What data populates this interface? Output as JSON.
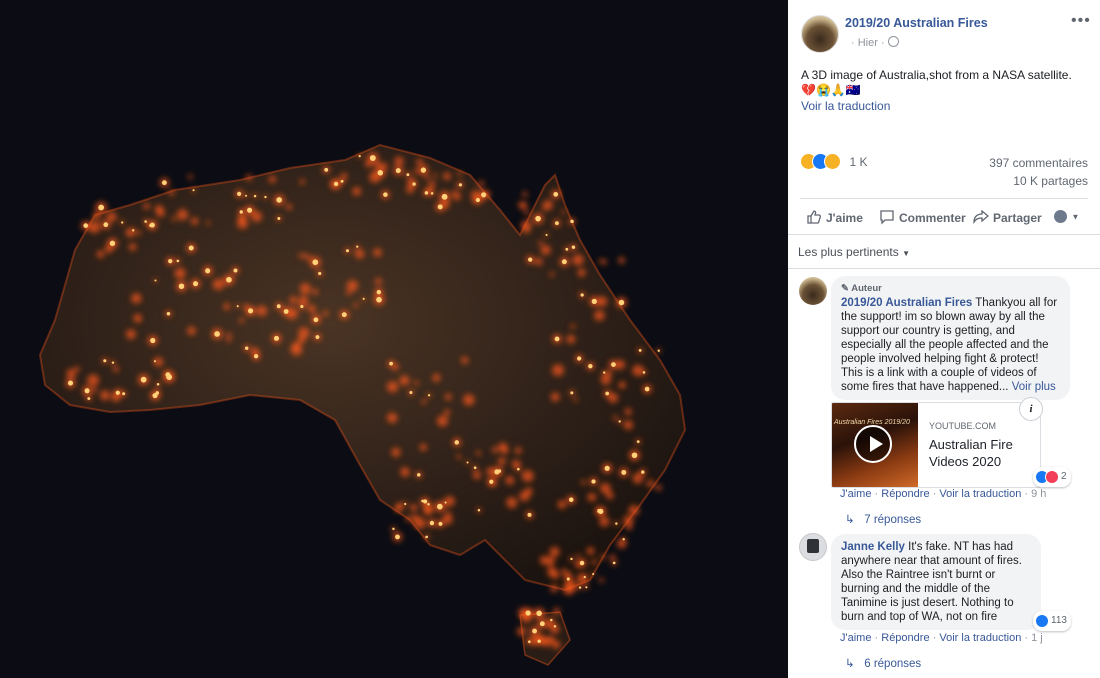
{
  "post": {
    "page_name": "2019/20 Australian Fires",
    "date": "Hier",
    "date_dot": "·",
    "more": "•••",
    "text": "A 3D image of Australia,shot from a NASA satellite.",
    "emojis": "💔😭🙏🇦🇺",
    "translate": "Voir la traduction",
    "reaction_count": "1 K",
    "comments_count": "397 commentaires",
    "shares_count": "10 K partages"
  },
  "actions": {
    "like": "J'aime",
    "comment": "Commenter",
    "share": "Partager"
  },
  "sort_label": "Les plus pertinents",
  "comments": [
    {
      "author_tag": "Auteur",
      "author": "2019/20 Australian Fires",
      "text_lines": [
        "Thankyou all for",
        "the support! im so blown away by all the",
        "support our country is getting, and",
        "especially all the people affected and the",
        "people involved helping fight & protect!",
        "This is a link with a couple of videos of",
        "some fires that have happened..."
      ],
      "see_more": "Voir plus",
      "link_card": {
        "thumb_title": "Australian Fires 2019/20",
        "domain": "YOUTUBE.COM",
        "title": "Australian Fire Videos 2020",
        "info": "i"
      },
      "reaction_count": "2",
      "like": "J'aime",
      "reply": "Répondre",
      "translate": "Voir la traduction",
      "time": "9 h",
      "sep": "·",
      "replies": "7 réponses"
    },
    {
      "author": "Janne Kelly",
      "text_lines": [
        "It's fake. NT has had",
        "anywhere near that amount of fires.",
        "Also the Raintree isn't burnt or",
        "burning and the middle of the",
        "Tanimine is just desert. Nothing to",
        "burn and top of WA, not on fire"
      ],
      "reaction_count": "113",
      "like": "J'aime",
      "reply": "Répondre",
      "translate": "Voir la traduction",
      "time": "1 j",
      "sep": "·",
      "replies": "6 réponses"
    }
  ],
  "colors": {
    "link": "#385898",
    "like_blue": "#1877f2",
    "fire": "#ff5a1a"
  }
}
